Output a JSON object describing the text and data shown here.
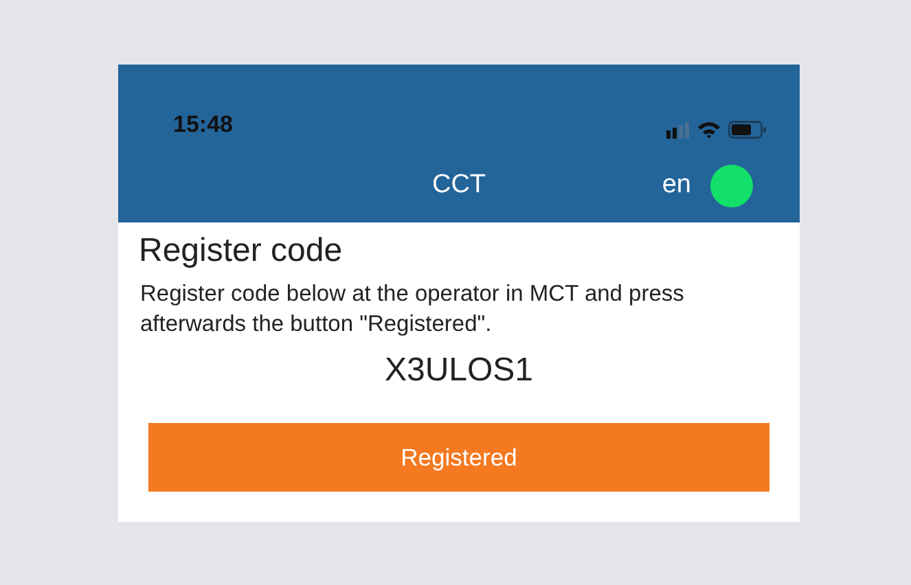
{
  "status_bar": {
    "time": "15:48"
  },
  "header": {
    "title": "CCT",
    "language": "en",
    "connected": true
  },
  "content": {
    "heading": "Register code",
    "instructions": "Register code below at the operator in MCT and press afterwards the button \"Registered\".",
    "code": "X3ULOS1",
    "button": "Registered"
  }
}
